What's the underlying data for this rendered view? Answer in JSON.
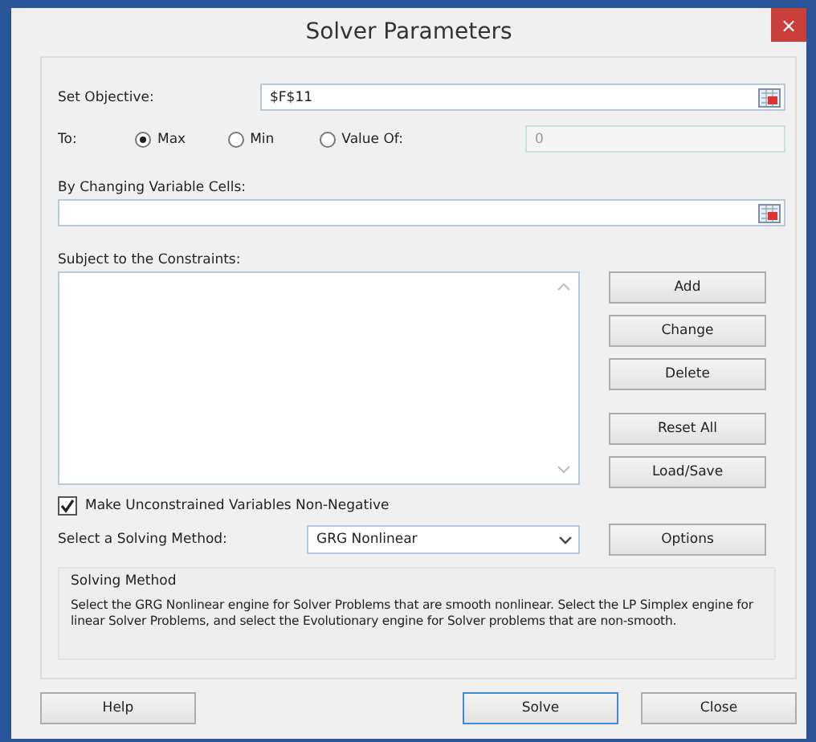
{
  "window": {
    "title": "Solver Parameters",
    "close": "×"
  },
  "objective": {
    "label": "Set Objective:",
    "value": "$F$11"
  },
  "to": {
    "label": "To:",
    "options": [
      {
        "label": "Max",
        "selected": true
      },
      {
        "label": "Min",
        "selected": false
      },
      {
        "label": "Value Of:",
        "selected": false
      }
    ],
    "value_field": {
      "value": "0",
      "disabled": true
    }
  },
  "changing_cells": {
    "label": "By Changing Variable Cells:"
  },
  "constraints": {
    "label": "Subject to the Constraints:",
    "buttons": [
      "Add",
      "Change",
      "Delete",
      "Reset All",
      "Load/Save"
    ]
  },
  "non_negative": {
    "label": "Make Unconstrained Variables Non-Negative",
    "checked": true
  },
  "method": {
    "label": "Select a Solving Method:",
    "value": "GRG Nonlinear",
    "options_button": "Options"
  },
  "solving_method": {
    "title": "Solving Method",
    "text": "Select the GRG Nonlinear engine for Solver Problems that are smooth nonlinear. Select the LP Simplex engine for linear Solver Problems, and select the Evolutionary engine for Solver problems that are non-smooth."
  },
  "buttons": [
    {
      "label": "Help",
      "default": false
    },
    {
      "label": "Solve",
      "default": true
    },
    {
      "label": "Close",
      "default": false
    }
  ]
}
